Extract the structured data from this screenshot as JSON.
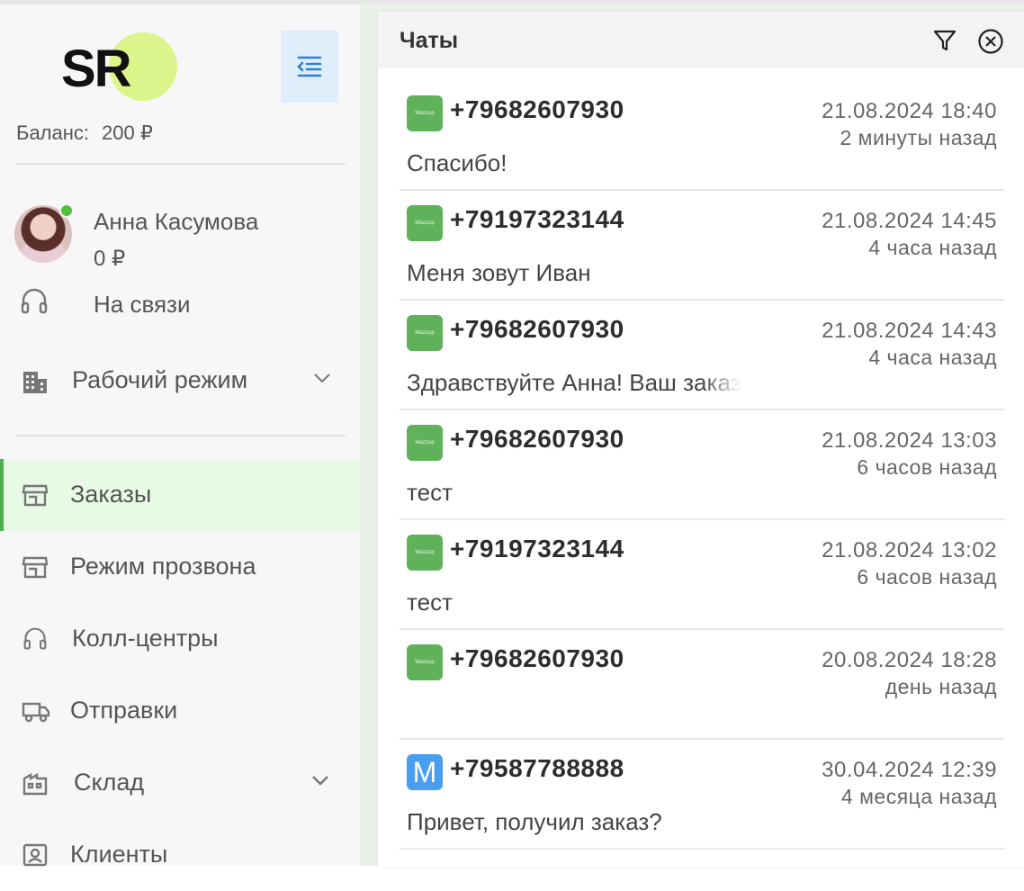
{
  "sidebar": {
    "logo_text": "SR",
    "balance_label": "Баланс:",
    "balance_value": "200 ₽",
    "user": {
      "name": "Анна Касумова",
      "balance": "0 ₽",
      "status": "На связи",
      "online": true
    },
    "mode": {
      "label": "Рабочий режим"
    },
    "nav": [
      {
        "label": "Заказы",
        "icon": "store-icon",
        "active": true
      },
      {
        "label": "Режим прозвона",
        "icon": "store-icon",
        "active": false
      },
      {
        "label": "Колл-центры",
        "icon": "headphones-icon",
        "active": false
      },
      {
        "label": "Отправки",
        "icon": "truck-icon",
        "active": false
      },
      {
        "label": "Склад",
        "icon": "warehouse-icon",
        "active": false,
        "expandable": true
      },
      {
        "label": "Клиенты",
        "icon": "contact-card-icon",
        "active": false
      }
    ]
  },
  "chats": {
    "title": "Чаты",
    "items": [
      {
        "badge": "Wazzup",
        "phone": "+79682607930",
        "date": "21.08.2024 18:40",
        "ago": "2 минуты назад",
        "message": "Спасибо!"
      },
      {
        "badge": "Wazzup",
        "phone": "+79197323144",
        "date": "21.08.2024 14:45",
        "ago": "4 часа назад",
        "message": "Меня зовут Иван"
      },
      {
        "badge": "Wazzup",
        "phone": "+79682607930",
        "date": "21.08.2024 14:43",
        "ago": "4 часа назад",
        "message": "Здравствуйте Анна! Ваш заказ"
      },
      {
        "badge": "Wazzup",
        "phone": "+79682607930",
        "date": "21.08.2024 13:03",
        "ago": "6 часов назад",
        "message": "тест"
      },
      {
        "badge": "Wazzup",
        "phone": "+79197323144",
        "date": "21.08.2024 13:02",
        "ago": "6 часов назад",
        "message": "тест"
      },
      {
        "badge": "Wazzup",
        "phone": "+79682607930",
        "date": "20.08.2024 18:28",
        "ago": "день назад",
        "message": ""
      },
      {
        "badge": "M",
        "phone": "+79587788888",
        "date": "30.04.2024 12:39",
        "ago": "4 месяца назад",
        "message": "Привет, получил заказ?"
      }
    ]
  },
  "colors": {
    "accent_green": "#4caf50",
    "active_bg": "#e8f9e6",
    "logo_circle": "#dcf48c",
    "collapse_btn_bg": "#e0eefc",
    "wazzup_badge": "#5fb25a",
    "m_badge": "#4a9ef0",
    "online_dot": "#51c13a"
  }
}
